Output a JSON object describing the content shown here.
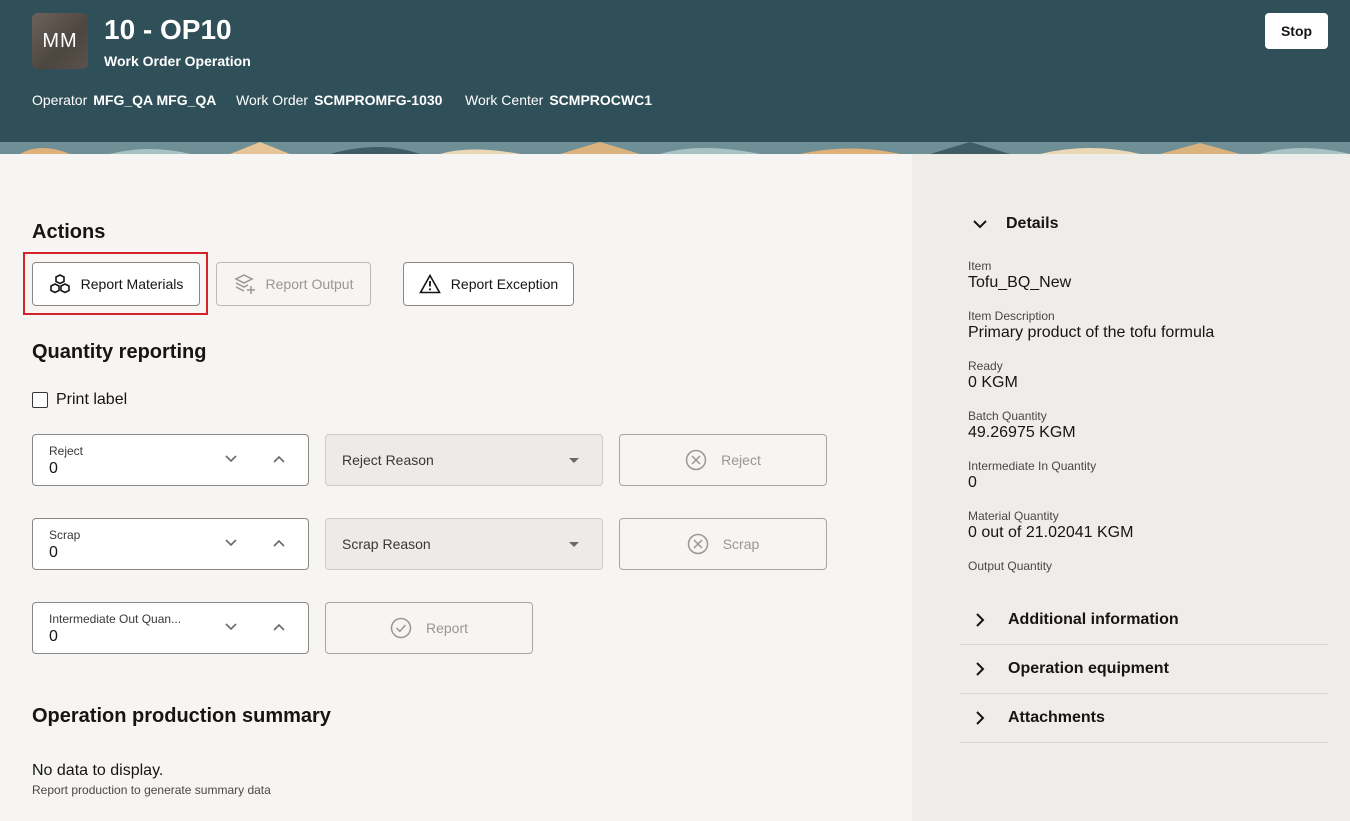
{
  "header": {
    "avatar_initials": "MM",
    "title": "10 - OP10",
    "subtitle": "Work Order Operation",
    "operator_label": "Operator",
    "operator_value": "MFG_QA MFG_QA",
    "work_order_label": "Work Order",
    "work_order_value": "SCMPROMFG-1030",
    "work_center_label": "Work Center",
    "work_center_value": "SCMPROCWC1",
    "stop_label": "Stop",
    "bg_color": "#2f5058"
  },
  "actions": {
    "heading": "Actions",
    "report_materials": "Report Materials",
    "report_output": "Report Output",
    "report_exception": "Report Exception"
  },
  "quantity": {
    "heading": "Quantity reporting",
    "print_label": "Print label",
    "reject": {
      "label": "Reject",
      "value": "0",
      "reason_placeholder": "Reject Reason",
      "button": "Reject"
    },
    "scrap": {
      "label": "Scrap",
      "value": "0",
      "reason_placeholder": "Scrap Reason",
      "button": "Scrap"
    },
    "intermediate": {
      "label": "Intermediate Out Quan...",
      "value": "0",
      "button": "Report"
    }
  },
  "summary": {
    "heading": "Operation production summary",
    "no_data": "No data to display.",
    "no_data_sub": "Report production to generate summary data"
  },
  "details": {
    "heading": "Details",
    "fields": [
      {
        "label": "Item",
        "value": "Tofu_BQ_New"
      },
      {
        "label": "Item Description",
        "value": "Primary product of the tofu formula"
      },
      {
        "label": "Ready",
        "value": "0 KGM"
      },
      {
        "label": "Batch Quantity",
        "value": "49.26975 KGM"
      },
      {
        "label": "Intermediate In Quantity",
        "value": "0"
      },
      {
        "label": "Material Quantity",
        "value": "0 out of 21.02041 KGM"
      },
      {
        "label": "Output Quantity",
        "value": ""
      }
    ],
    "sections": [
      "Additional information",
      "Operation equipment",
      "Attachments"
    ]
  },
  "colors": {
    "highlight": "#d6202a"
  }
}
